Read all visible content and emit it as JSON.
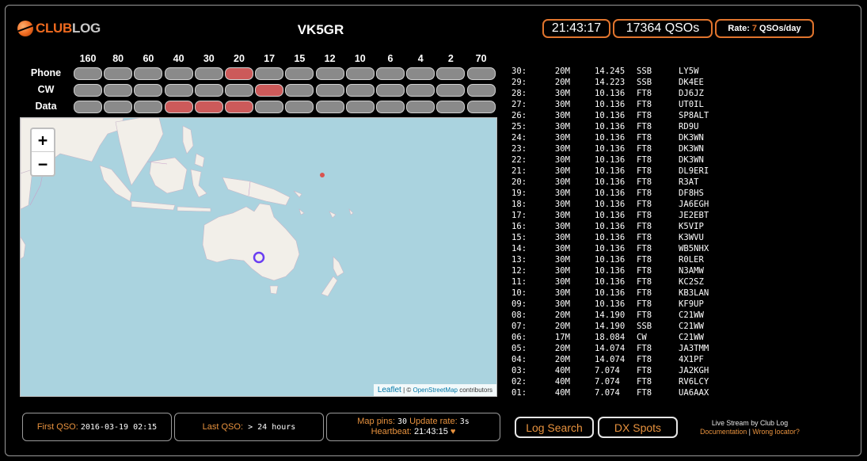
{
  "header": {
    "logo": {
      "club": "CLUB",
      "log": "LOG"
    },
    "callsign": "VK5GR",
    "clock": "21:43:17",
    "qso_count": "17364 QSOs",
    "rate": {
      "prefix": "Rate:",
      "value": "7",
      "suffix": "QSOs/day"
    }
  },
  "grid": {
    "bands": [
      "160",
      "80",
      "60",
      "40",
      "30",
      "20",
      "17",
      "15",
      "12",
      "10",
      "6",
      "4",
      "2",
      "70"
    ],
    "modes": [
      {
        "label": "Phone",
        "active": [
          false,
          false,
          false,
          false,
          false,
          true,
          false,
          false,
          false,
          false,
          false,
          false,
          false,
          false
        ]
      },
      {
        "label": "CW",
        "active": [
          false,
          false,
          false,
          false,
          false,
          false,
          true,
          false,
          false,
          false,
          false,
          false,
          false,
          false
        ]
      },
      {
        "label": "Data",
        "active": [
          false,
          false,
          false,
          true,
          true,
          true,
          false,
          false,
          false,
          false,
          false,
          false,
          false,
          false
        ]
      }
    ],
    "colors": {
      "active": "#cc5a5a",
      "inactive": "#8a8a8a"
    }
  },
  "map": {
    "zoom_in": "+",
    "zoom_out": "−",
    "attribution": {
      "leaflet": "Leaflet",
      "sep": " | © ",
      "osm": "OpenStreetMap",
      "contrib": " contributors"
    }
  },
  "qso_log": [
    {
      "idx": "30:",
      "band": "20M",
      "freq": "14.245",
      "mode": "SSB",
      "call": "LY5W"
    },
    {
      "idx": "29:",
      "band": "20M",
      "freq": "14.223",
      "mode": "SSB",
      "call": "DK4EE"
    },
    {
      "idx": "28:",
      "band": "30M",
      "freq": "10.136",
      "mode": "FT8",
      "call": "DJ6JZ"
    },
    {
      "idx": "27:",
      "band": "30M",
      "freq": "10.136",
      "mode": "FT8",
      "call": "UT0IL"
    },
    {
      "idx": "26:",
      "band": "30M",
      "freq": "10.136",
      "mode": "FT8",
      "call": "SP8ALT"
    },
    {
      "idx": "25:",
      "band": "30M",
      "freq": "10.136",
      "mode": "FT8",
      "call": "RD9U"
    },
    {
      "idx": "24:",
      "band": "30M",
      "freq": "10.136",
      "mode": "FT8",
      "call": "DK3WN"
    },
    {
      "idx": "23:",
      "band": "30M",
      "freq": "10.136",
      "mode": "FT8",
      "call": "DK3WN"
    },
    {
      "idx": "22:",
      "band": "30M",
      "freq": "10.136",
      "mode": "FT8",
      "call": "DK3WN"
    },
    {
      "idx": "21:",
      "band": "30M",
      "freq": "10.136",
      "mode": "FT8",
      "call": "DL9ERI"
    },
    {
      "idx": "20:",
      "band": "30M",
      "freq": "10.136",
      "mode": "FT8",
      "call": "R3AT"
    },
    {
      "idx": "19:",
      "band": "30M",
      "freq": "10.136",
      "mode": "FT8",
      "call": "DF8HS"
    },
    {
      "idx": "18:",
      "band": "30M",
      "freq": "10.136",
      "mode": "FT8",
      "call": "JA6EGH"
    },
    {
      "idx": "17:",
      "band": "30M",
      "freq": "10.136",
      "mode": "FT8",
      "call": "JE2EBT"
    },
    {
      "idx": "16:",
      "band": "30M",
      "freq": "10.136",
      "mode": "FT8",
      "call": "K5VIP"
    },
    {
      "idx": "15:",
      "band": "30M",
      "freq": "10.136",
      "mode": "FT8",
      "call": "K3WVU"
    },
    {
      "idx": "14:",
      "band": "30M",
      "freq": "10.136",
      "mode": "FT8",
      "call": "WB5NHX"
    },
    {
      "idx": "13:",
      "band": "30M",
      "freq": "10.136",
      "mode": "FT8",
      "call": "R0LER"
    },
    {
      "idx": "12:",
      "band": "30M",
      "freq": "10.136",
      "mode": "FT8",
      "call": "N3AMW"
    },
    {
      "idx": "11:",
      "band": "30M",
      "freq": "10.136",
      "mode": "FT8",
      "call": "KC2SZ"
    },
    {
      "idx": "10:",
      "band": "30M",
      "freq": "10.136",
      "mode": "FT8",
      "call": "KB3LAN"
    },
    {
      "idx": "09:",
      "band": "30M",
      "freq": "10.136",
      "mode": "FT8",
      "call": "KF9UP"
    },
    {
      "idx": "08:",
      "band": "20M",
      "freq": "14.190",
      "mode": "FT8",
      "call": "C21WW"
    },
    {
      "idx": "07:",
      "band": "20M",
      "freq": "14.190",
      "mode": "SSB",
      "call": "C21WW"
    },
    {
      "idx": "06:",
      "band": "17M",
      "freq": "18.084",
      "mode": "CW",
      "call": "C21WW"
    },
    {
      "idx": "05:",
      "band": "20M",
      "freq": "14.074",
      "mode": "FT8",
      "call": "JA3TMM"
    },
    {
      "idx": "04:",
      "band": "20M",
      "freq": "14.074",
      "mode": "FT8",
      "call": "4X1PF"
    },
    {
      "idx": "03:",
      "band": "40M",
      "freq": "7.074",
      "mode": "FT8",
      "call": "JA2KGH"
    },
    {
      "idx": "02:",
      "band": "40M",
      "freq": "7.074",
      "mode": "FT8",
      "call": "RV6LCY"
    },
    {
      "idx": "01:",
      "band": "40M",
      "freq": "7.074",
      "mode": "FT8",
      "call": "UA6AAX"
    }
  ],
  "footer": {
    "first_qso_label": "First QSO:",
    "first_qso_value": "2016-03-19 02:15",
    "last_qso_label": "Last QSO:",
    "last_qso_value": "> 24 hours",
    "map_pins_label": "Map pins:",
    "map_pins_value": "30",
    "update_rate_label": "Update rate:",
    "update_rate_value": "3s",
    "heartbeat_label": "Heartbeat:",
    "heartbeat_value": "21:43:15",
    "heart": "♥",
    "log_search": "Log Search",
    "dx_spots": "DX Spots",
    "live_stream": "Live Stream by Club Log",
    "documentation": "Documentation",
    "link_sep": " | ",
    "wrong_locator": "Wrong locator?"
  },
  "colors": {
    "accent": "#e0742d",
    "background": "#000000",
    "sea": "#aad3df",
    "land": "#f2efe9"
  }
}
